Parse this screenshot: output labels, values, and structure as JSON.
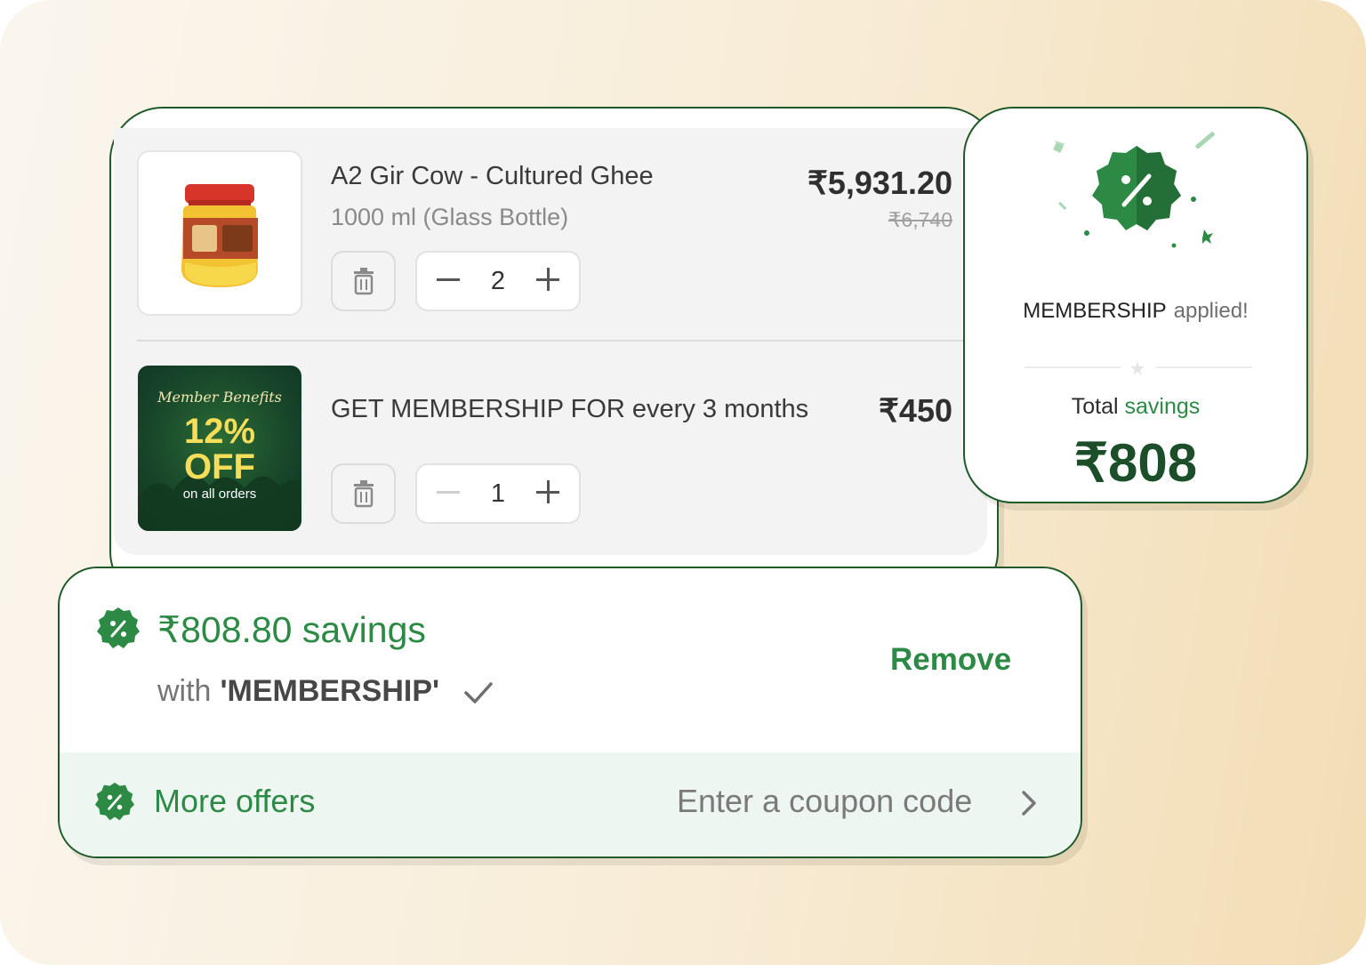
{
  "colors": {
    "brand_green": "#1f5a28",
    "accent_green": "#2d8a45",
    "background": "#f8ecd6"
  },
  "cart": {
    "items": [
      {
        "title": "A2 Gir Cow - Cultured Ghee",
        "variant": "1000 ml (Glass Bottle)",
        "price": "₹5,931.20",
        "original_price": "₹6,740",
        "quantity": "2",
        "image": "ghee-jar-image"
      },
      {
        "title": "GET MEMBERSHIP FOR every 3 months",
        "price": "₹450",
        "quantity": "1",
        "image": "membership-banner-image",
        "banner": {
          "line1": "Member Benefits",
          "line2": "12%",
          "line3": "OFF",
          "line4": "on all orders"
        }
      }
    ],
    "delete_icon": "trash-icon",
    "decrease_icon": "minus-icon",
    "increase_icon": "plus-icon"
  },
  "membership_popup": {
    "code": "MEMBERSHIP",
    "status": "applied!",
    "total_label_prefix": "Total",
    "total_label_suffix": "savings",
    "total_value": "₹808",
    "icon": "discount-badge-icon"
  },
  "savings_panel": {
    "amount_text": "₹808.80 savings",
    "with_text": "with",
    "code_text": "'MEMBERSHIP'",
    "remove_label": "Remove",
    "more_offers_label": "More offers",
    "coupon_label": "Enter a coupon code",
    "icon": "discount-badge-icon"
  }
}
